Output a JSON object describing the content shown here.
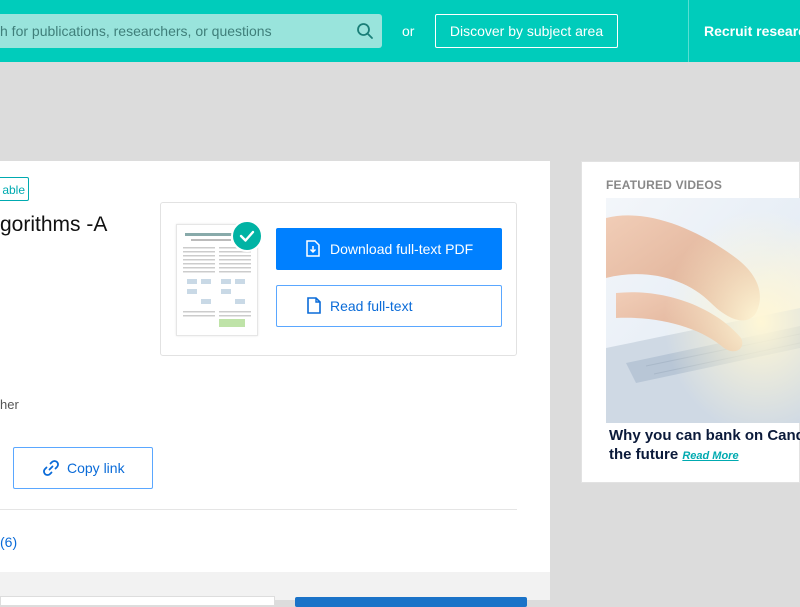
{
  "header": {
    "search_placeholder": "h for publications, researchers, or questions",
    "or_label": "or",
    "discover_label": "Discover by subject area",
    "recruit_label": "Recruit researchers"
  },
  "publication": {
    "badge": "able",
    "title_fragment": "gorithms -A",
    "author_fragment": "her",
    "download_label": "Download full-text PDF",
    "read_label": "Read full-text",
    "copy_link_label": "Copy link",
    "count_fragment": "(6)"
  },
  "sidebar": {
    "featured_label": "FEATURED VIDEOS",
    "headline_line1": "Why you can bank on Cand",
    "headline_line2": "the future",
    "read_more": "Read More"
  },
  "colors": {
    "brand": "#00ccbb",
    "primary_button": "#0080ff",
    "accent_teal": "#00b3a4"
  },
  "icons": [
    "search-icon",
    "download-file-icon",
    "file-icon",
    "link-icon",
    "check-icon"
  ]
}
